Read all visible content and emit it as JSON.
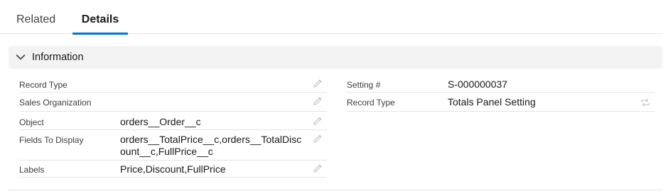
{
  "tabs": {
    "related": "Related",
    "details": "Details"
  },
  "section": {
    "title": "Information"
  },
  "left_fields": [
    {
      "label": "Record Type",
      "value": ""
    },
    {
      "label": "Sales Organization",
      "value": ""
    },
    {
      "label": "Object",
      "value": "orders__Order__c"
    },
    {
      "label": "Fields To Display",
      "value_line1": "orders__TotalPrice__c,orders__TotalDisc",
      "value_line2": "ount__c,FullPrice__c"
    },
    {
      "label": "Labels",
      "value": "Price,Discount,FullPrice"
    }
  ],
  "right_fields": [
    {
      "label": "Setting #",
      "value": "S-000000037"
    },
    {
      "label": "Record Type",
      "value": "Totals Panel Setting"
    }
  ],
  "icons": {
    "chevron": "chevron-down-icon",
    "edit": "pencil-icon",
    "change_record_type": "change-record-type-icon"
  },
  "colors": {
    "accent": "#0176d3",
    "section_bg": "#f3f3f3",
    "divider": "#e5e5e5",
    "icon": "#c9c9c9"
  }
}
